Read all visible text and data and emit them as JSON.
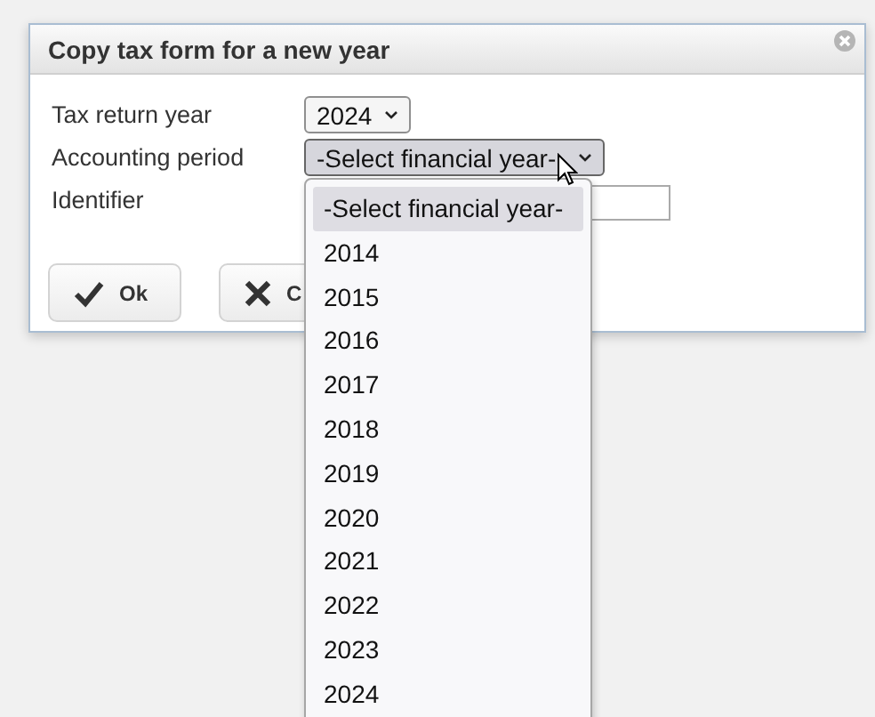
{
  "dialog": {
    "title": "Copy tax form for a new year",
    "fields": [
      {
        "kind": "select",
        "label": "Tax return year",
        "value": "2024",
        "open": false
      },
      {
        "kind": "select",
        "label": "Accounting period",
        "value": "-Select financial year-",
        "open": true
      },
      {
        "kind": "text",
        "label": "Identifier"
      }
    ],
    "buttons": [
      {
        "label": "Ok",
        "kind": "ok"
      },
      {
        "label": "C",
        "kind": "cancel"
      }
    ]
  },
  "dropdown": {
    "options": [
      {
        "label": "-Select financial year-",
        "selected": true
      },
      {
        "label": "2014",
        "selected": false
      },
      {
        "label": "2015",
        "selected": false
      },
      {
        "label": "2016",
        "selected": false
      },
      {
        "label": "2017",
        "selected": false
      },
      {
        "label": "2018",
        "selected": false
      },
      {
        "label": "2019",
        "selected": false
      },
      {
        "label": "2020",
        "selected": false
      },
      {
        "label": "2021",
        "selected": false
      },
      {
        "label": "2022",
        "selected": false
      },
      {
        "label": "2023",
        "selected": false
      },
      {
        "label": "2024",
        "selected": false
      }
    ]
  }
}
